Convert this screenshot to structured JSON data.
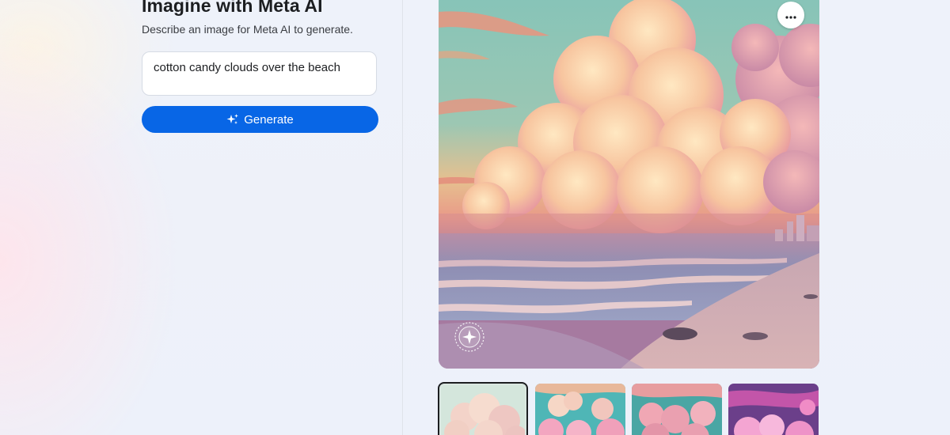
{
  "panel": {
    "title": "Imagine with Meta AI",
    "subtitle": "Describe an image for Meta AI to generate.",
    "prompt_value": "cotton candy clouds over the beach",
    "generate_label": "Generate"
  },
  "main_image": {
    "more_options_icon": "ellipsis-icon",
    "watermark_icon": "imagined-with-ai-badge"
  },
  "thumbnails": {
    "count": 4,
    "selected_index": 0
  },
  "colors": {
    "accent": "#0866e6",
    "background": "#eef1f9",
    "text": "#1c1e21"
  }
}
